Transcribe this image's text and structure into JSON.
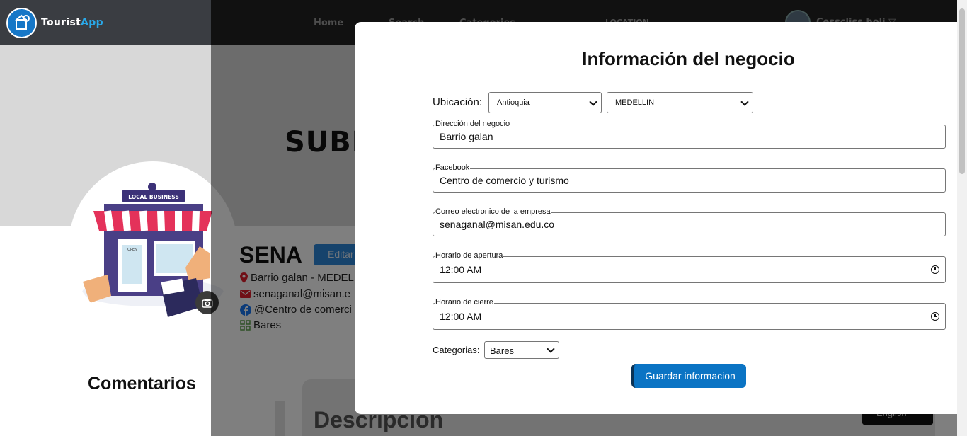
{
  "navbar": {
    "logo_text_main": "Tourist",
    "logo_text_accent": "App",
    "links": [
      "Home",
      "Search",
      "Categories",
      "LOCATION"
    ],
    "user_name": "Cesscliss holi ▽"
  },
  "banner": {
    "text": "SUBE"
  },
  "illustration": {
    "sign_text": "LOCAL BUSINESS",
    "door_sign": "OPEN"
  },
  "business": {
    "name": "SENA",
    "edit_label": "Editar",
    "address": "Barrio galan - MEDEL",
    "email": "senaganal@misan.e",
    "facebook": "@Centro de comerci",
    "category": "Bares"
  },
  "comentarios_heading": "Comentarios",
  "description_heading": "Descripcion",
  "language_button": "English",
  "modal": {
    "title": "Información del negocio",
    "location_label": "Ubicación:",
    "department_selected": "Antioquia",
    "city_selected": "MEDELLIN",
    "fields": {
      "address": {
        "legend": "Dirección del negocio",
        "value": "Barrio galan"
      },
      "facebook": {
        "legend": "Facebook",
        "value": "Centro de comercio y turismo"
      },
      "email": {
        "legend": "Correo electronico de la empresa",
        "value": "senaganal@misan.edu.co"
      },
      "open_time": {
        "legend": "Horario de apertura",
        "value": "12:00 AM"
      },
      "close_time": {
        "legend": "Horario de cierre",
        "value": "12:00 AM"
      }
    },
    "category_label": "Categorias:",
    "category_selected": "Bares",
    "save_label": "Guardar informacion"
  },
  "colors": {
    "primary_button": "#0b74c4",
    "navbar": "#232323",
    "overlay": "rgba(0,0,0,0.5)"
  }
}
